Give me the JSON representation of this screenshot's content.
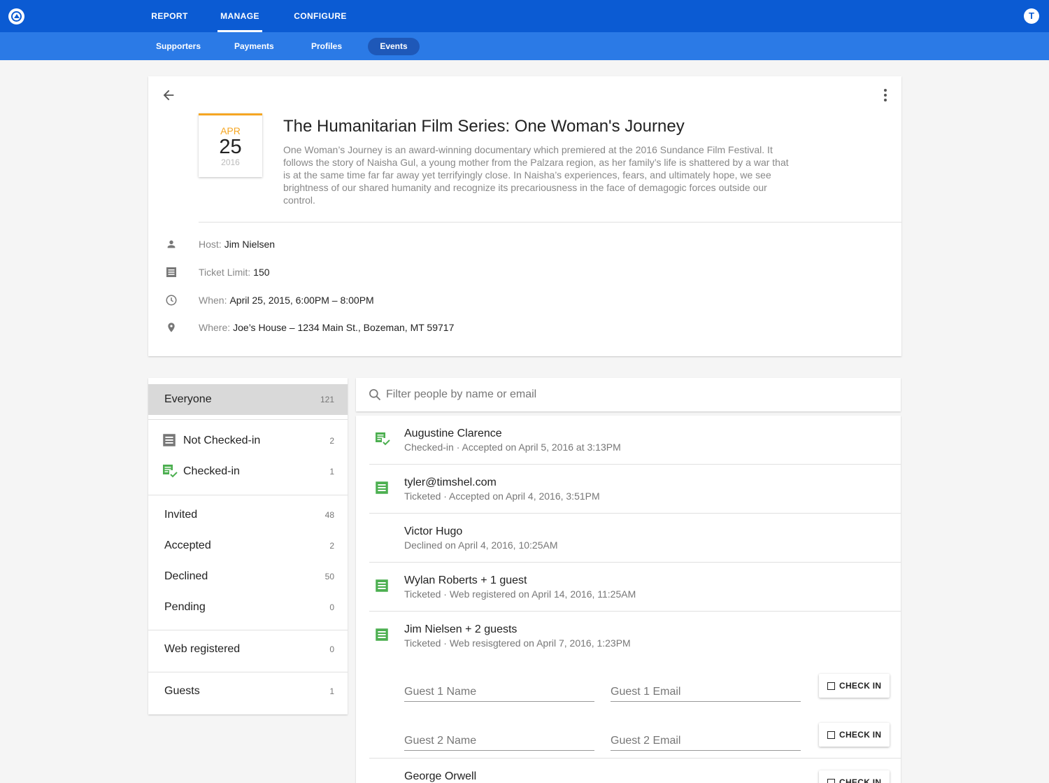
{
  "nav": {
    "main_tabs": [
      {
        "label": "REPORT"
      },
      {
        "label": "MANAGE",
        "active": true
      },
      {
        "label": "CONFIGURE"
      }
    ],
    "user_initial": "T",
    "sub_tabs": [
      {
        "label": "Supporters"
      },
      {
        "label": "Payments"
      },
      {
        "label": "Profiles"
      },
      {
        "label": "Events",
        "active": true
      }
    ]
  },
  "event": {
    "date": {
      "month": "APR",
      "day": "25",
      "year": "2016"
    },
    "title": "The Humanitarian Film Series: One Woman's Journey",
    "description": "One Woman’s Journey is an award-winning documentary which premiered at the 2016 Sundance Film Festival. It follows the story of Naisha Gul, a young mother from the Palzara region, as her family’s life is shattered by a war that is at the same time far far away yet terrifyingly close.  In Naisha’s experiences, fears, and ultimately hope, we see brightness of our shared humanity and recognize its precariousness in the face of demagogic forces outside our control.",
    "details": [
      {
        "icon": "person-icon",
        "label": "Host:",
        "value": "Jim Nielsen"
      },
      {
        "icon": "ticket-icon",
        "label": "Ticket Limit:",
        "value": "150"
      },
      {
        "icon": "clock-icon",
        "label": "When:",
        "value": "April 25, 2015, 6:00PM – 8:00PM"
      },
      {
        "icon": "location-pin-icon",
        "label": "Where:",
        "value": "Joe’s House – 1234 Main St., Bozeman, MT 59717"
      }
    ]
  },
  "filters": [
    {
      "label": "Everyone",
      "count": "121",
      "active": true
    },
    {
      "label": "Not Checked-in",
      "count": "2",
      "icon": "ticket-icon"
    },
    {
      "label": "Checked-in",
      "count": "1",
      "icon": "checked-in-icon"
    },
    {
      "label": "Invited",
      "count": "48"
    },
    {
      "label": "Accepted",
      "count": "2"
    },
    {
      "label": "Declined",
      "count": "50"
    },
    {
      "label": "Pending",
      "count": "0"
    },
    {
      "label": "Web registered",
      "count": "0"
    },
    {
      "label": "Guests",
      "count": "1"
    }
  ],
  "search": {
    "placeholder": "Filter people by name or email"
  },
  "people": [
    {
      "name": "Augustine Clarence",
      "status": "Checked-in · Accepted on April 5, 2016 at 3:13PM",
      "icon": "checked-in-icon"
    },
    {
      "name": "tyler@timshel.com",
      "status": "Ticketed · Accepted on April 4, 2016, 3:51PM",
      "icon": "ticket-icon"
    },
    {
      "name": "Victor Hugo",
      "status": "Declined on April 4, 2016, 10:25AM",
      "icon": ""
    },
    {
      "name": "Wylan Roberts + 1 guest",
      "status": "Ticketed · Web registered on April 14, 2016, 11:25AM",
      "icon": "ticket-icon"
    },
    {
      "name": "Jim Nielsen + 2 guests",
      "status": "Ticketed · Web resisgtered on April 7, 2016, 1:23PM",
      "icon": "ticket-icon"
    },
    {
      "name": "George Orwell",
      "status": "",
      "icon": ""
    }
  ],
  "guests": [
    {
      "name_placeholder": "Guest 1 Name",
      "email_placeholder": "Guest 1 Email",
      "button": "CHECK IN"
    },
    {
      "name_placeholder": "Guest 2 Name",
      "email_placeholder": "Guest 2 Email",
      "button": "CHECK IN"
    }
  ],
  "george_button": "CHECK IN",
  "colors": {
    "primary": "#0b5bd3",
    "subnav": "#2b7ae6",
    "accent_orange": "#f5a623",
    "ticket_green": "#4caf50"
  }
}
